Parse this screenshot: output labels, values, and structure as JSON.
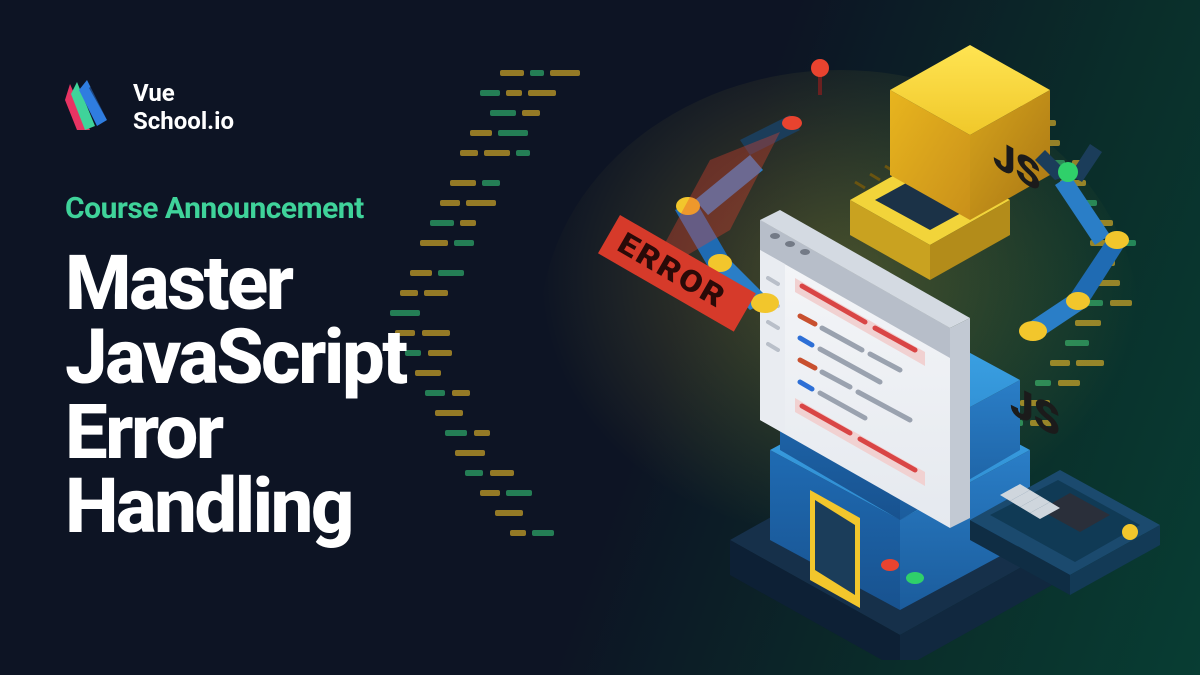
{
  "brand": {
    "name_line1": "Vue",
    "name_line2": "School.io"
  },
  "subtitle": "Course Announcement",
  "title_line1": "Master",
  "title_line2": "JavaScript",
  "title_line3": "Error",
  "title_line4": "Handling",
  "illustration": {
    "js_badge": "JS",
    "error_flag": "ERROR"
  },
  "colors": {
    "accent_green": "#3fd39a",
    "bg_dark": "#0d1424",
    "bg_teal": "#083d33"
  }
}
